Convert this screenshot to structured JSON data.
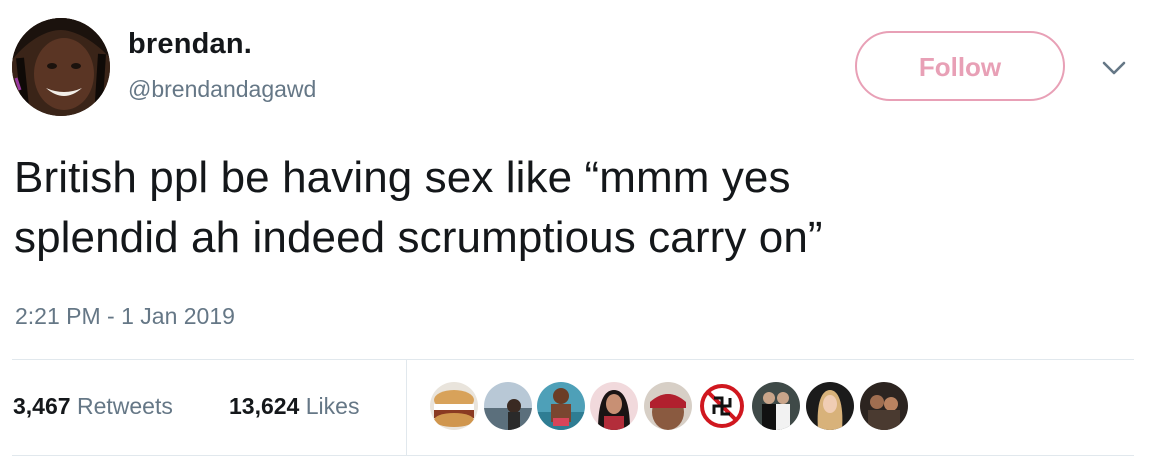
{
  "author": {
    "display_name": "brendan.",
    "handle": "@brendandagawd"
  },
  "follow_button": {
    "label": "Follow"
  },
  "tweet": {
    "text_line1": "British ppl be having sex like “mmm yes",
    "text_line2": "splendid ah indeed scrumptious carry on”",
    "timestamp": "2:21 PM - 1 Jan 2019"
  },
  "stats": {
    "retweets_count": "3,467",
    "retweets_label": "Retweets",
    "likes_count": "13,624",
    "likes_label": "Likes"
  },
  "colors": {
    "follow_accent": "#e8a0b6",
    "secondary_text": "#657786",
    "primary_text": "#14171a",
    "divider": "#e1e8ed"
  },
  "icons": {
    "menu": "chevron-down-icon"
  }
}
